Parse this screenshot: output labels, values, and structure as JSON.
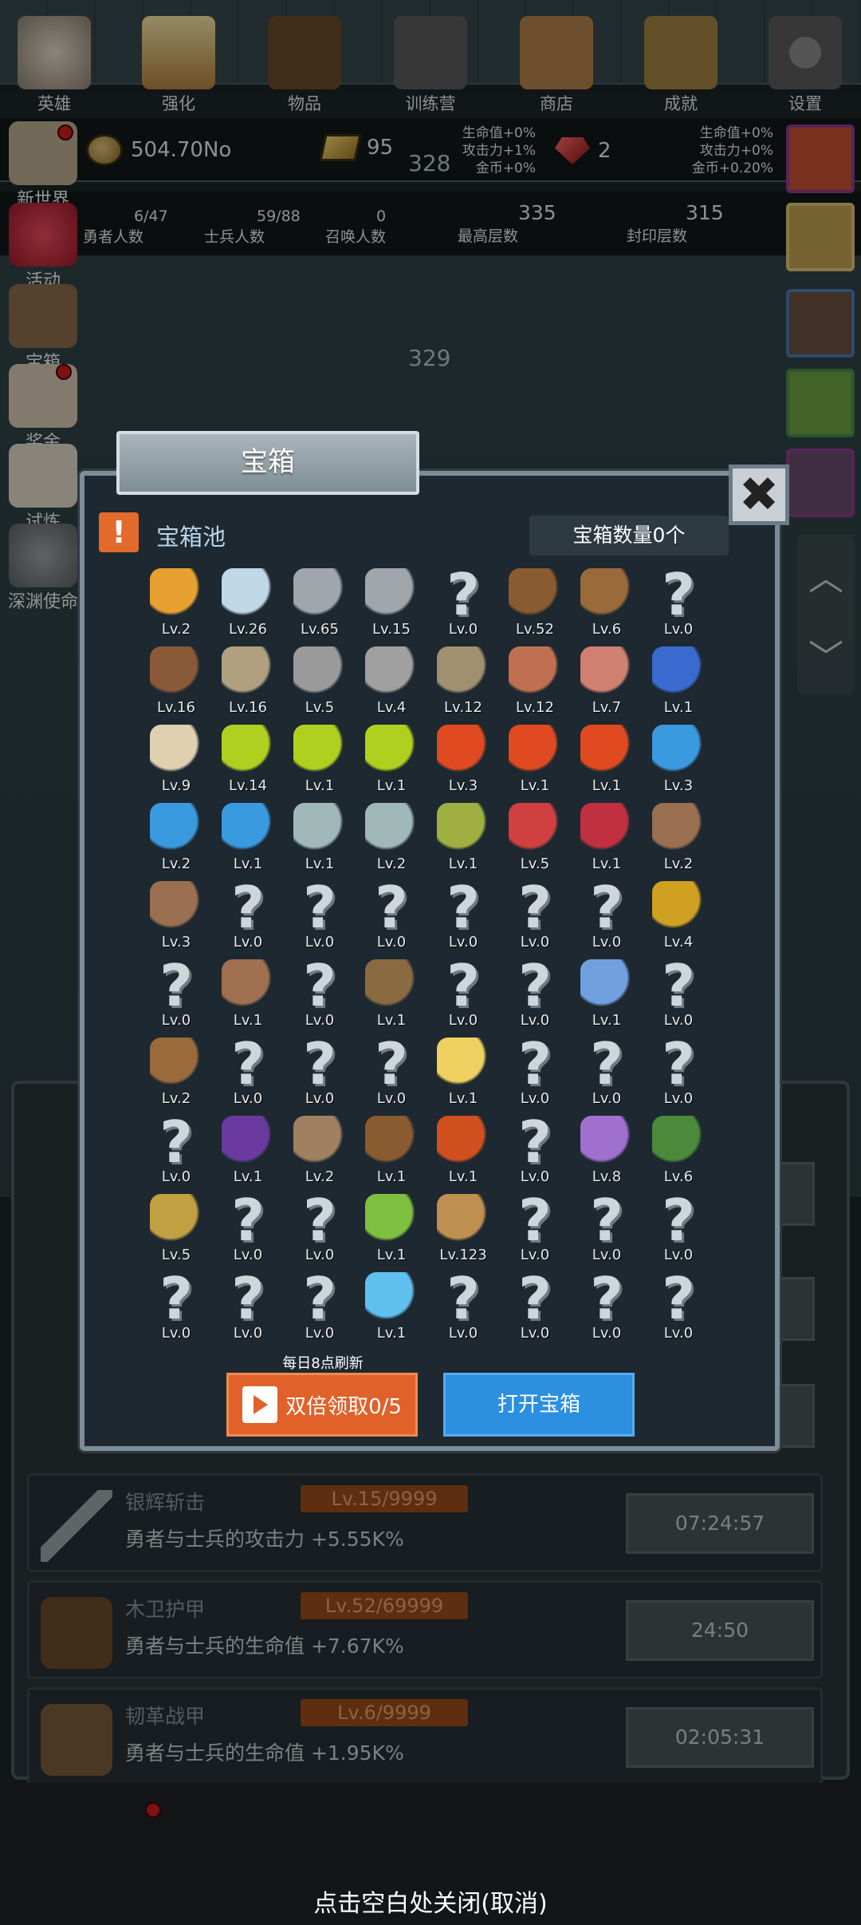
{
  "hud": {
    "floor_top": "328",
    "floor_mid": "329",
    "gold": "504.70No",
    "bars": "95",
    "gems": "2",
    "bonus_left": [
      "生命值+0%",
      "攻击力+1%",
      "金币+0%"
    ],
    "bonus_right": [
      "生命值+0%",
      "攻击力+0%",
      "金币+0.20%"
    ],
    "heroes": {
      "value": "6/47",
      "label": "勇者人数"
    },
    "soldiers": {
      "value": "59/88",
      "label": "士兵人数"
    },
    "summons": {
      "value": "0",
      "label": "召唤人数"
    },
    "max_floor": {
      "value": "335",
      "label": "最高层数"
    },
    "seal_floor": {
      "value": "315",
      "label": "封印层数"
    }
  },
  "left_menu": [
    {
      "label": "新世界",
      "icon": "scroll-icon"
    },
    {
      "label": "活动",
      "icon": "heart-icon"
    },
    {
      "label": "宝箱",
      "icon": "chest-icon"
    },
    {
      "label": "奖金",
      "icon": "envelope-icon"
    },
    {
      "label": "试炼",
      "icon": "feather-icon"
    },
    {
      "label": "深渊使命",
      "icon": "skull-orb-icon"
    }
  ],
  "list_rows": [
    {
      "name": "银辉斩击",
      "level": "Lv.15/9999",
      "desc": "勇者与士兵的攻击力 +5.55K%",
      "timer": "07:24:57",
      "icon": "sword-icon"
    },
    {
      "name": "木卫护甲",
      "level": "Lv.52/69999",
      "desc": "勇者与士兵的生命值 +7.67K%",
      "timer": "24:50",
      "icon": "leather-armor-icon"
    },
    {
      "name": "韧革战甲",
      "level": "Lv.6/9999",
      "desc": "勇者与士兵的生命值 +1.95K%",
      "timer": "02:05:31",
      "icon": "backpack-armor-icon"
    }
  ],
  "nav": [
    {
      "label": "英雄",
      "icon": "skull-icon"
    },
    {
      "label": "强化",
      "icon": "candle-icon"
    },
    {
      "label": "物品",
      "icon": "book-icon"
    },
    {
      "label": "训练营",
      "icon": "lantern-icon"
    },
    {
      "label": "商店",
      "icon": "mug-icon"
    },
    {
      "label": "成就",
      "icon": "key-icon"
    },
    {
      "label": "设置",
      "icon": "gear-icon"
    }
  ],
  "close_hint": "点击空白处关闭(取消)",
  "dialog": {
    "title": "宝箱",
    "pool_title": "宝箱池",
    "pool_alert": "!",
    "count_label": "宝箱数量0个",
    "refresh_note": "每日8点刷新",
    "double_btn": "双倍领取0/5",
    "open_btn": "打开宝箱",
    "close_glyph": "✖",
    "items": [
      {
        "icon": "crown-icon",
        "lv": "Lv.2"
      },
      {
        "icon": "diamond-icon",
        "lv": "Lv.26"
      },
      {
        "icon": "sword-icon",
        "lv": "Lv.65"
      },
      {
        "icon": "sword-icon",
        "lv": "Lv.15"
      },
      {
        "icon": "unknown-icon",
        "lv": "Lv.0"
      },
      {
        "icon": "leather-armor-icon",
        "lv": "Lv.52"
      },
      {
        "icon": "backpack-icon",
        "lv": "Lv.6"
      },
      {
        "icon": "unknown-icon",
        "lv": "Lv.0"
      },
      {
        "icon": "helmet-icon",
        "lv": "Lv.16"
      },
      {
        "icon": "dagger-icon",
        "lv": "Lv.16"
      },
      {
        "icon": "knight-helm-icon",
        "lv": "Lv.5"
      },
      {
        "icon": "hammer-icon",
        "lv": "Lv.4"
      },
      {
        "icon": "great-helm-icon",
        "lv": "Lv.12"
      },
      {
        "icon": "meat-icon",
        "lv": "Lv.12"
      },
      {
        "icon": "steak-icon",
        "lv": "Lv.7"
      },
      {
        "icon": "blue-pouch-icon",
        "lv": "Lv.1"
      },
      {
        "icon": "bread-icon",
        "lv": "Lv.9"
      },
      {
        "icon": "yellow-potion-icon",
        "lv": "Lv.14"
      },
      {
        "icon": "yellow-potion-icon",
        "lv": "Lv.1"
      },
      {
        "icon": "yellow-potion-icon",
        "lv": "Lv.1"
      },
      {
        "icon": "red-potion-icon",
        "lv": "Lv.3"
      },
      {
        "icon": "red-potion-icon",
        "lv": "Lv.1"
      },
      {
        "icon": "red-potion-icon",
        "lv": "Lv.1"
      },
      {
        "icon": "blue-potion-icon",
        "lv": "Lv.3"
      },
      {
        "icon": "blue-potion-icon",
        "lv": "Lv.2"
      },
      {
        "icon": "blue-potion-icon",
        "lv": "Lv.1"
      },
      {
        "icon": "empty-bottle-icon",
        "lv": "Lv.1"
      },
      {
        "icon": "empty-bottle-icon",
        "lv": "Lv.2"
      },
      {
        "icon": "green-bottle-icon",
        "lv": "Lv.1"
      },
      {
        "icon": "red-bottle-icon",
        "lv": "Lv.5"
      },
      {
        "icon": "winged-boot-icon",
        "lv": "Lv.1"
      },
      {
        "icon": "boot-icon",
        "lv": "Lv.2"
      },
      {
        "icon": "boot-icon",
        "lv": "Lv.3"
      },
      {
        "icon": "unknown-icon",
        "lv": "Lv.0"
      },
      {
        "icon": "unknown-icon",
        "lv": "Lv.0"
      },
      {
        "icon": "unknown-icon",
        "lv": "Lv.0"
      },
      {
        "icon": "unknown-icon",
        "lv": "Lv.0"
      },
      {
        "icon": "unknown-icon",
        "lv": "Lv.0"
      },
      {
        "icon": "unknown-icon",
        "lv": "Lv.0"
      },
      {
        "icon": "torch-icon",
        "lv": "Lv.4"
      },
      {
        "icon": "unknown-icon",
        "lv": "Lv.0"
      },
      {
        "icon": "mushroom-icon",
        "lv": "Lv.1"
      },
      {
        "icon": "unknown-icon",
        "lv": "Lv.0"
      },
      {
        "icon": "staff-icon",
        "lv": "Lv.1"
      },
      {
        "icon": "unknown-icon",
        "lv": "Lv.0"
      },
      {
        "icon": "unknown-icon",
        "lv": "Lv.0"
      },
      {
        "icon": "magic-wand-icon",
        "lv": "Lv.1"
      },
      {
        "icon": "unknown-icon",
        "lv": "Lv.0"
      },
      {
        "icon": "backpack-icon",
        "lv": "Lv.2"
      },
      {
        "icon": "unknown-icon",
        "lv": "Lv.0"
      },
      {
        "icon": "unknown-icon",
        "lv": "Lv.0"
      },
      {
        "icon": "unknown-icon",
        "lv": "Lv.0"
      },
      {
        "icon": "cheese-icon",
        "lv": "Lv.1"
      },
      {
        "icon": "unknown-icon",
        "lv": "Lv.0"
      },
      {
        "icon": "unknown-icon",
        "lv": "Lv.0"
      },
      {
        "icon": "unknown-icon",
        "lv": "Lv.0"
      },
      {
        "icon": "unknown-icon",
        "lv": "Lv.0"
      },
      {
        "icon": "magic-cube-icon",
        "lv": "Lv.1"
      },
      {
        "icon": "bow-icon",
        "lv": "Lv.2"
      },
      {
        "icon": "quiver-icon",
        "lv": "Lv.1"
      },
      {
        "icon": "fire-glove-icon",
        "lv": "Lv.1"
      },
      {
        "icon": "unknown-icon",
        "lv": "Lv.0"
      },
      {
        "icon": "gem-cluster-icon",
        "lv": "Lv.8"
      },
      {
        "icon": "emblem-shield-icon",
        "lv": "Lv.6"
      },
      {
        "icon": "vial-icon",
        "lv": "Lv.5"
      },
      {
        "icon": "unknown-icon",
        "lv": "Lv.0"
      },
      {
        "icon": "unknown-icon",
        "lv": "Lv.0"
      },
      {
        "icon": "green-wand-icon",
        "lv": "Lv.1"
      },
      {
        "icon": "beer-mug-icon",
        "lv": "Lv.123"
      },
      {
        "icon": "unknown-icon",
        "lv": "Lv.0"
      },
      {
        "icon": "unknown-icon",
        "lv": "Lv.0"
      },
      {
        "icon": "unknown-icon",
        "lv": "Lv.0"
      },
      {
        "icon": "unknown-icon",
        "lv": "Lv.0"
      },
      {
        "icon": "unknown-icon",
        "lv": "Lv.0"
      },
      {
        "icon": "unknown-icon",
        "lv": "Lv.0"
      },
      {
        "icon": "crystal-ball-icon",
        "lv": "Lv.1"
      },
      {
        "icon": "unknown-icon",
        "lv": "Lv.0"
      },
      {
        "icon": "unknown-icon",
        "lv": "Lv.0"
      },
      {
        "icon": "unknown-icon",
        "lv": "Lv.0"
      },
      {
        "icon": "unknown-icon",
        "lv": "Lv.0"
      }
    ]
  },
  "colors": {
    "accent_orange": "#e0622a",
    "accent_blue": "#2c8fe0",
    "level_badge": "#9a4a1a",
    "panel": "#1d2830"
  }
}
